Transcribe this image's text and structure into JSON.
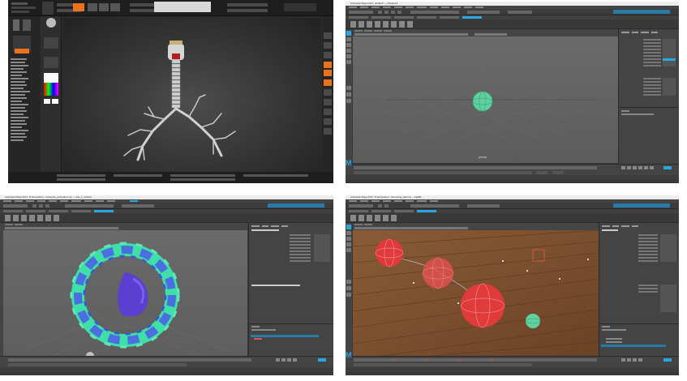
{
  "zbrush": {
    "colors": {
      "accent": "#e8731e",
      "background": "#2b2b2b"
    },
    "left_menu_items": [
      "Alpha",
      "Brush",
      "Color",
      "Document",
      "Draw",
      "Edit",
      "File",
      "Layer",
      "Light",
      "Macro",
      "Marker",
      "Material",
      "Movie",
      "Picker",
      "Preferences",
      "Render",
      "Stencil",
      "Stroke",
      "Texture",
      "Tool",
      "Transform",
      "Zplugin",
      "Zscript"
    ]
  },
  "maya_windows": [
    {
      "title": "Autodesk Maya 2017: untitled* --- pSphere1",
      "panel_label": "persp",
      "outliner_tabs": [
        "Channels",
        "Edit",
        "Object",
        "Show"
      ],
      "object_name": "pSphere1"
    },
    {
      "title": "Autodesk Maya 2017: D:/animation/.../molecule_animation.ma --- dna_1_surface",
      "panel_label": "persp",
      "outliner_tabs": [
        "Display",
        "Anim"
      ],
      "object_name": "dna_1_surface"
    },
    {
      "title": "Autodesk Maya 2017: D:/animation/.../bouncing_ball.ma --- ballMc",
      "panel_label": "persp",
      "outliner_tabs": [
        "Display",
        "Anim"
      ],
      "object_name": "ballMc"
    }
  ],
  "colors": {
    "maya_panel": "#444444",
    "maya_accent": "#2aa6e0",
    "floor": "#7a5030",
    "sphere_green": "#5fd1a0",
    "sphere_red": "#e03a3a",
    "dna_teal": "#3fe0a8",
    "dna_blue": "#4b6ee0",
    "dna_purple": "#5a3fd0"
  },
  "maya_logo": "M"
}
